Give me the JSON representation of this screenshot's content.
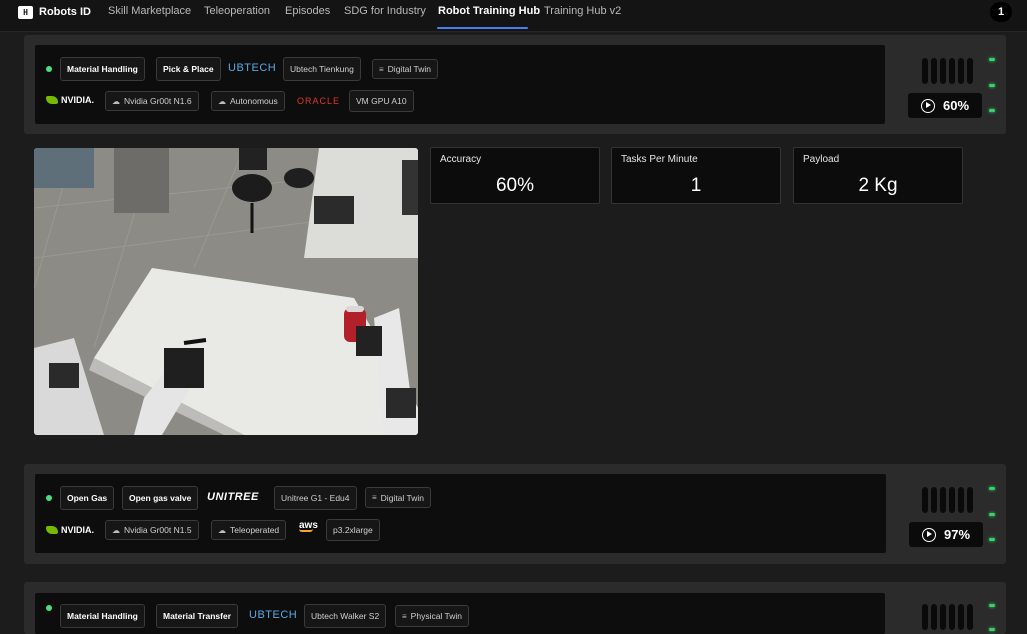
{
  "nav": {
    "brand": "Robots ID",
    "brand_mark": "H",
    "tabs": [
      {
        "label": "Skill Marketplace"
      },
      {
        "label": "Teleoperation"
      },
      {
        "label": "Episodes"
      },
      {
        "label": "SDG for Industry"
      },
      {
        "label": "Robot Training Hub"
      },
      {
        "label": "Training Hub v2"
      }
    ],
    "active_tab": "Robot Training Hub",
    "count_badge": "1",
    "accent": "#4d7bf0"
  },
  "robots": [
    {
      "task": "Material Handling",
      "subtask": "Pick & Place",
      "maker_logo": "UBTECH",
      "model": "Ubtech Tienkung",
      "twin": "Digital Twin",
      "ai_logo": "NVIDIA.",
      "ai_model": "Nvidia Gr00t N1.6",
      "mode": "Autonomous",
      "cloud_logo": "ORACLE",
      "compute": "VM GPU A10",
      "progress": "60%"
    },
    {
      "task": "Open Gas",
      "subtask": "Open gas valve",
      "maker_logo": "UNITREE",
      "model": "Unitree G1 - Edu4",
      "twin": "Digital Twin",
      "ai_logo": "NVIDIA.",
      "ai_model": "Nvidia Gr00t N1.5",
      "mode": "Teleoperated",
      "cloud_logo": "aws",
      "compute": "p3.2xlarge",
      "progress": "97%"
    },
    {
      "task": "Material Handling",
      "subtask": "Material Transfer",
      "maker_logo": "UBTECH",
      "model": "Ubtech Walker S2",
      "twin": "Physical Twin"
    }
  ],
  "metrics": [
    {
      "label": "Accuracy",
      "value": "60%"
    },
    {
      "label": "Tasks Per Minute",
      "value": "1"
    },
    {
      "label": "Payload",
      "value": "2 Kg"
    }
  ],
  "colors": {
    "status_green": "#4ade80",
    "led_green": "#34d26b",
    "ubtech_blue": "#5aa9e6",
    "nvidia_green": "#76b900",
    "oracle_red": "#e0342b"
  }
}
